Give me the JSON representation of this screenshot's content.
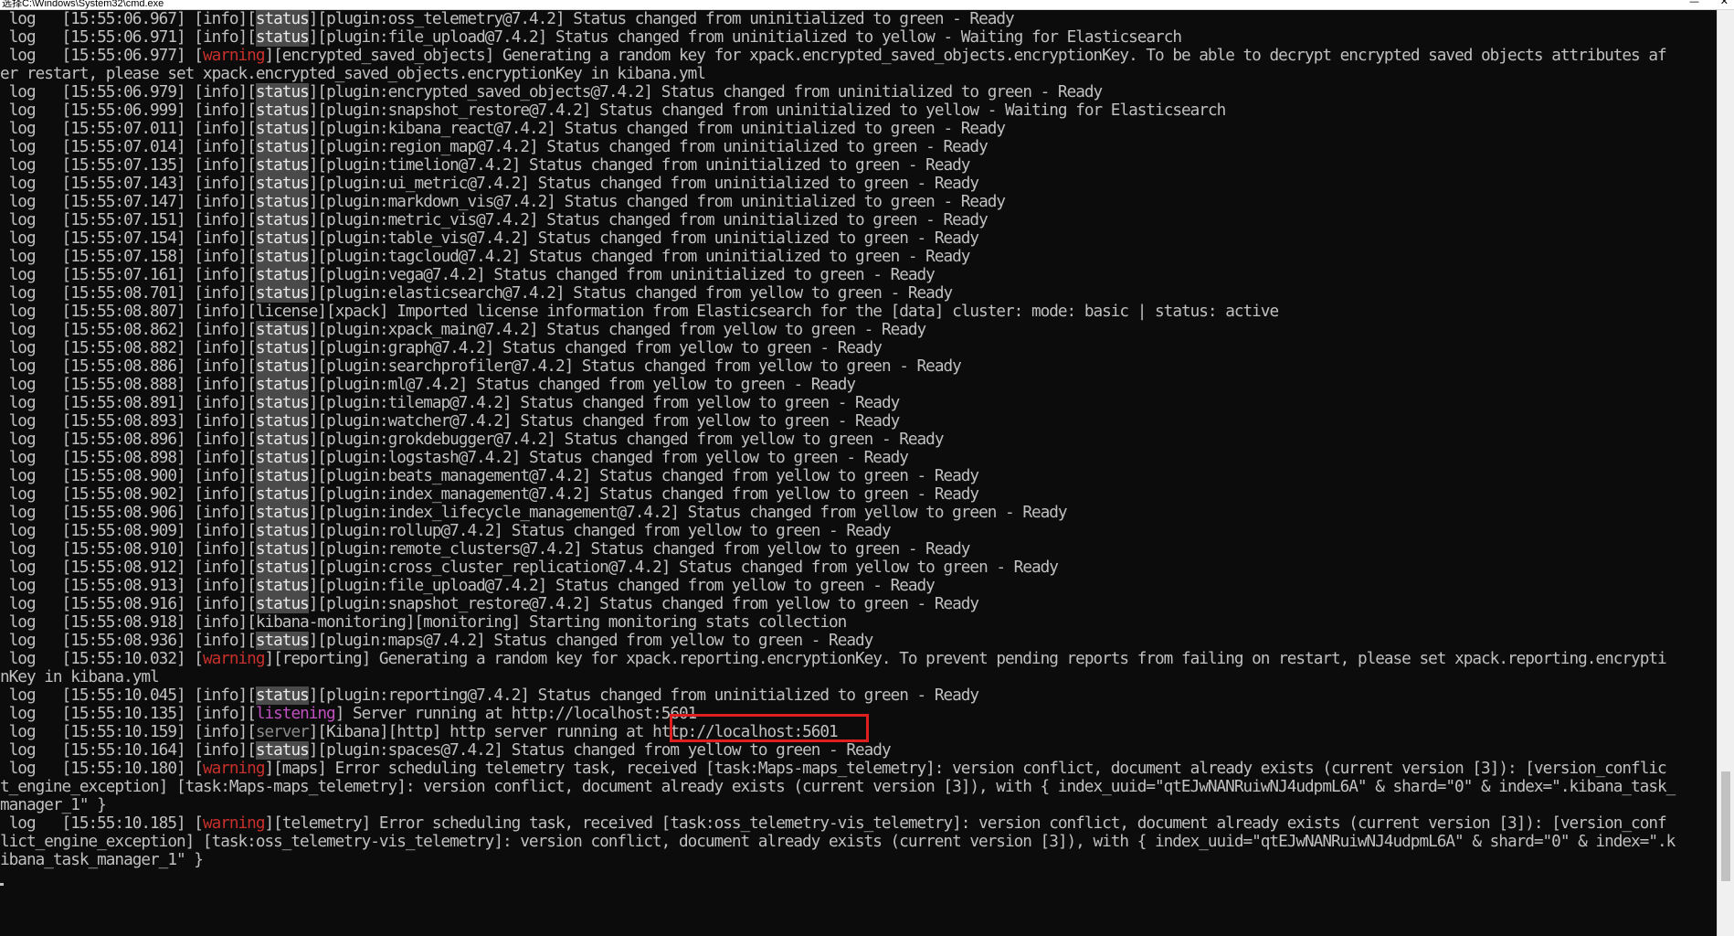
{
  "window": {
    "title": "选择C:\\Windows\\System32\\cmd.exe",
    "minimize_label": "—",
    "close_label": "✕"
  },
  "console": {
    "lines": [
      {
        "prefix": " log   [15:55:06.967] ",
        "level": "info",
        "tag": "status",
        "rest": "[plugin:oss_telemetry@7.4.2] Status changed from uninitialized to green - Ready"
      },
      {
        "prefix": " log   [15:55:06.971] ",
        "level": "info",
        "tag": "status",
        "rest": "[plugin:file_upload@7.4.2] Status changed from uninitialized to yellow - Waiting for Elasticsearch"
      },
      {
        "prefix": " log   [15:55:06.977] ",
        "level": "warning",
        "tag": "",
        "rest": "[encrypted_saved_objects] Generating a random key for xpack.encrypted_saved_objects.encryptionKey. To be able to decrypt encrypted saved objects attributes af"
      },
      {
        "prefix": "er restart, please set xpack.encrypted_saved_objects.encryptionKey in kibana.yml",
        "level": "",
        "tag": "",
        "rest": ""
      },
      {
        "prefix": " log   [15:55:06.979] ",
        "level": "info",
        "tag": "status",
        "rest": "[plugin:encrypted_saved_objects@7.4.2] Status changed from uninitialized to green - Ready"
      },
      {
        "prefix": " log   [15:55:06.999] ",
        "level": "info",
        "tag": "status",
        "rest": "[plugin:snapshot_restore@7.4.2] Status changed from uninitialized to yellow - Waiting for Elasticsearch"
      },
      {
        "prefix": " log   [15:55:07.011] ",
        "level": "info",
        "tag": "status",
        "rest": "[plugin:kibana_react@7.4.2] Status changed from uninitialized to green - Ready"
      },
      {
        "prefix": " log   [15:55:07.014] ",
        "level": "info",
        "tag": "status",
        "rest": "[plugin:region_map@7.4.2] Status changed from uninitialized to green - Ready"
      },
      {
        "prefix": " log   [15:55:07.135] ",
        "level": "info",
        "tag": "status",
        "rest": "[plugin:timelion@7.4.2] Status changed from uninitialized to green - Ready"
      },
      {
        "prefix": " log   [15:55:07.143] ",
        "level": "info",
        "tag": "status",
        "rest": "[plugin:ui_metric@7.4.2] Status changed from uninitialized to green - Ready"
      },
      {
        "prefix": " log   [15:55:07.147] ",
        "level": "info",
        "tag": "status",
        "rest": "[plugin:markdown_vis@7.4.2] Status changed from uninitialized to green - Ready"
      },
      {
        "prefix": " log   [15:55:07.151] ",
        "level": "info",
        "tag": "status",
        "rest": "[plugin:metric_vis@7.4.2] Status changed from uninitialized to green - Ready"
      },
      {
        "prefix": " log   [15:55:07.154] ",
        "level": "info",
        "tag": "status",
        "rest": "[plugin:table_vis@7.4.2] Status changed from uninitialized to green - Ready"
      },
      {
        "prefix": " log   [15:55:07.158] ",
        "level": "info",
        "tag": "status",
        "rest": "[plugin:tagcloud@7.4.2] Status changed from uninitialized to green - Ready"
      },
      {
        "prefix": " log   [15:55:07.161] ",
        "level": "info",
        "tag": "status",
        "rest": "[plugin:vega@7.4.2] Status changed from uninitialized to green - Ready"
      },
      {
        "prefix": " log   [15:55:08.701] ",
        "level": "info",
        "tag": "status",
        "rest": "[plugin:elasticsearch@7.4.2] Status changed from yellow to green - Ready"
      },
      {
        "prefix": " log   [15:55:08.807] ",
        "level": "info",
        "tag": "",
        "rest": "[license][xpack] Imported license information from Elasticsearch for the [data] cluster: mode: basic | status: active"
      },
      {
        "prefix": " log   [15:55:08.862] ",
        "level": "info",
        "tag": "status",
        "rest": "[plugin:xpack_main@7.4.2] Status changed from yellow to green - Ready"
      },
      {
        "prefix": " log   [15:55:08.882] ",
        "level": "info",
        "tag": "status",
        "rest": "[plugin:graph@7.4.2] Status changed from yellow to green - Ready"
      },
      {
        "prefix": " log   [15:55:08.886] ",
        "level": "info",
        "tag": "status",
        "rest": "[plugin:searchprofiler@7.4.2] Status changed from yellow to green - Ready"
      },
      {
        "prefix": " log   [15:55:08.888] ",
        "level": "info",
        "tag": "status",
        "rest": "[plugin:ml@7.4.2] Status changed from yellow to green - Ready"
      },
      {
        "prefix": " log   [15:55:08.891] ",
        "level": "info",
        "tag": "status",
        "rest": "[plugin:tilemap@7.4.2] Status changed from yellow to green - Ready"
      },
      {
        "prefix": " log   [15:55:08.893] ",
        "level": "info",
        "tag": "status",
        "rest": "[plugin:watcher@7.4.2] Status changed from yellow to green - Ready"
      },
      {
        "prefix": " log   [15:55:08.896] ",
        "level": "info",
        "tag": "status",
        "rest": "[plugin:grokdebugger@7.4.2] Status changed from yellow to green - Ready"
      },
      {
        "prefix": " log   [15:55:08.898] ",
        "level": "info",
        "tag": "status",
        "rest": "[plugin:logstash@7.4.2] Status changed from yellow to green - Ready"
      },
      {
        "prefix": " log   [15:55:08.900] ",
        "level": "info",
        "tag": "status",
        "rest": "[plugin:beats_management@7.4.2] Status changed from yellow to green - Ready"
      },
      {
        "prefix": " log   [15:55:08.902] ",
        "level": "info",
        "tag": "status",
        "rest": "[plugin:index_management@7.4.2] Status changed from yellow to green - Ready"
      },
      {
        "prefix": " log   [15:55:08.906] ",
        "level": "info",
        "tag": "status",
        "rest": "[plugin:index_lifecycle_management@7.4.2] Status changed from yellow to green - Ready"
      },
      {
        "prefix": " log   [15:55:08.909] ",
        "level": "info",
        "tag": "status",
        "rest": "[plugin:rollup@7.4.2] Status changed from yellow to green - Ready"
      },
      {
        "prefix": " log   [15:55:08.910] ",
        "level": "info",
        "tag": "status",
        "rest": "[plugin:remote_clusters@7.4.2] Status changed from yellow to green - Ready"
      },
      {
        "prefix": " log   [15:55:08.912] ",
        "level": "info",
        "tag": "status",
        "rest": "[plugin:cross_cluster_replication@7.4.2] Status changed from yellow to green - Ready"
      },
      {
        "prefix": " log   [15:55:08.913] ",
        "level": "info",
        "tag": "status",
        "rest": "[plugin:file_upload@7.4.2] Status changed from yellow to green - Ready"
      },
      {
        "prefix": " log   [15:55:08.916] ",
        "level": "info",
        "tag": "status",
        "rest": "[plugin:snapshot_restore@7.4.2] Status changed from yellow to green - Ready"
      },
      {
        "prefix": " log   [15:55:08.918] ",
        "level": "info",
        "tag": "",
        "rest": "[kibana-monitoring][monitoring] Starting monitoring stats collection"
      },
      {
        "prefix": " log   [15:55:08.936] ",
        "level": "info",
        "tag": "status",
        "rest": "[plugin:maps@7.4.2] Status changed from yellow to green - Ready"
      },
      {
        "prefix": " log   [15:55:10.032] ",
        "level": "warning",
        "tag": "",
        "rest": "[reporting] Generating a random key for xpack.reporting.encryptionKey. To prevent pending reports from failing on restart, please set xpack.reporting.encrypti"
      },
      {
        "prefix": "nKey in kibana.yml",
        "level": "",
        "tag": "",
        "rest": ""
      },
      {
        "prefix": " log   [15:55:10.045] ",
        "level": "info",
        "tag": "status",
        "rest": "[plugin:reporting@7.4.2] Status changed from uninitialized to green - Ready"
      },
      {
        "prefix": " log   [15:55:10.135] ",
        "level": "info",
        "tag": "listening",
        "rest": " Server running at http://localhost:5601"
      },
      {
        "prefix": " log   [15:55:10.159] ",
        "level": "info",
        "tag": "server",
        "rest": "[Kibana][http] http server running at http://localhost:5601"
      },
      {
        "prefix": " log   [15:55:10.164] ",
        "level": "info",
        "tag": "status",
        "rest": "[plugin:spaces@7.4.2] Status changed from yellow to green - Ready"
      },
      {
        "prefix": " log   [15:55:10.180] ",
        "level": "warning",
        "tag": "",
        "rest": "[maps] Error scheduling telemetry task, received [task:Maps-maps_telemetry]: version conflict, document already exists (current version [3]): [version_conflic"
      },
      {
        "prefix": "t_engine_exception] [task:Maps-maps_telemetry]: version conflict, document already exists (current version [3]), with { index_uuid=\"qtEJwNANRuiwNJ4udpmL6A\" & shard=\"0\" & index=\".kibana_task_",
        "level": "",
        "tag": "",
        "rest": ""
      },
      {
        "prefix": "manager_1\" }",
        "level": "",
        "tag": "",
        "rest": ""
      },
      {
        "prefix": " log   [15:55:10.185] ",
        "level": "warning",
        "tag": "",
        "rest": "[telemetry] Error scheduling task, received [task:oss_telemetry-vis_telemetry]: version conflict, document already exists (current version [3]): [version_conf"
      },
      {
        "prefix": "lict_engine_exception] [task:oss_telemetry-vis_telemetry]: version conflict, document already exists (current version [3]), with { index_uuid=\"qtEJwNANRuiwNJ4udpmL6A\" & shard=\"0\" & index=\".k",
        "level": "",
        "tag": "",
        "rest": ""
      },
      {
        "prefix": "ibana_task_manager_1\" }",
        "level": "",
        "tag": "",
        "rest": ""
      }
    ]
  },
  "colors": {
    "background": "#0c0c0c",
    "text": "#c0c0c0",
    "warning": "#c9302c",
    "status_tag_bg": "#4a4a4a",
    "listening": "#c050c0",
    "server": "#8a8a8a",
    "highlight_box": "#e02020"
  }
}
